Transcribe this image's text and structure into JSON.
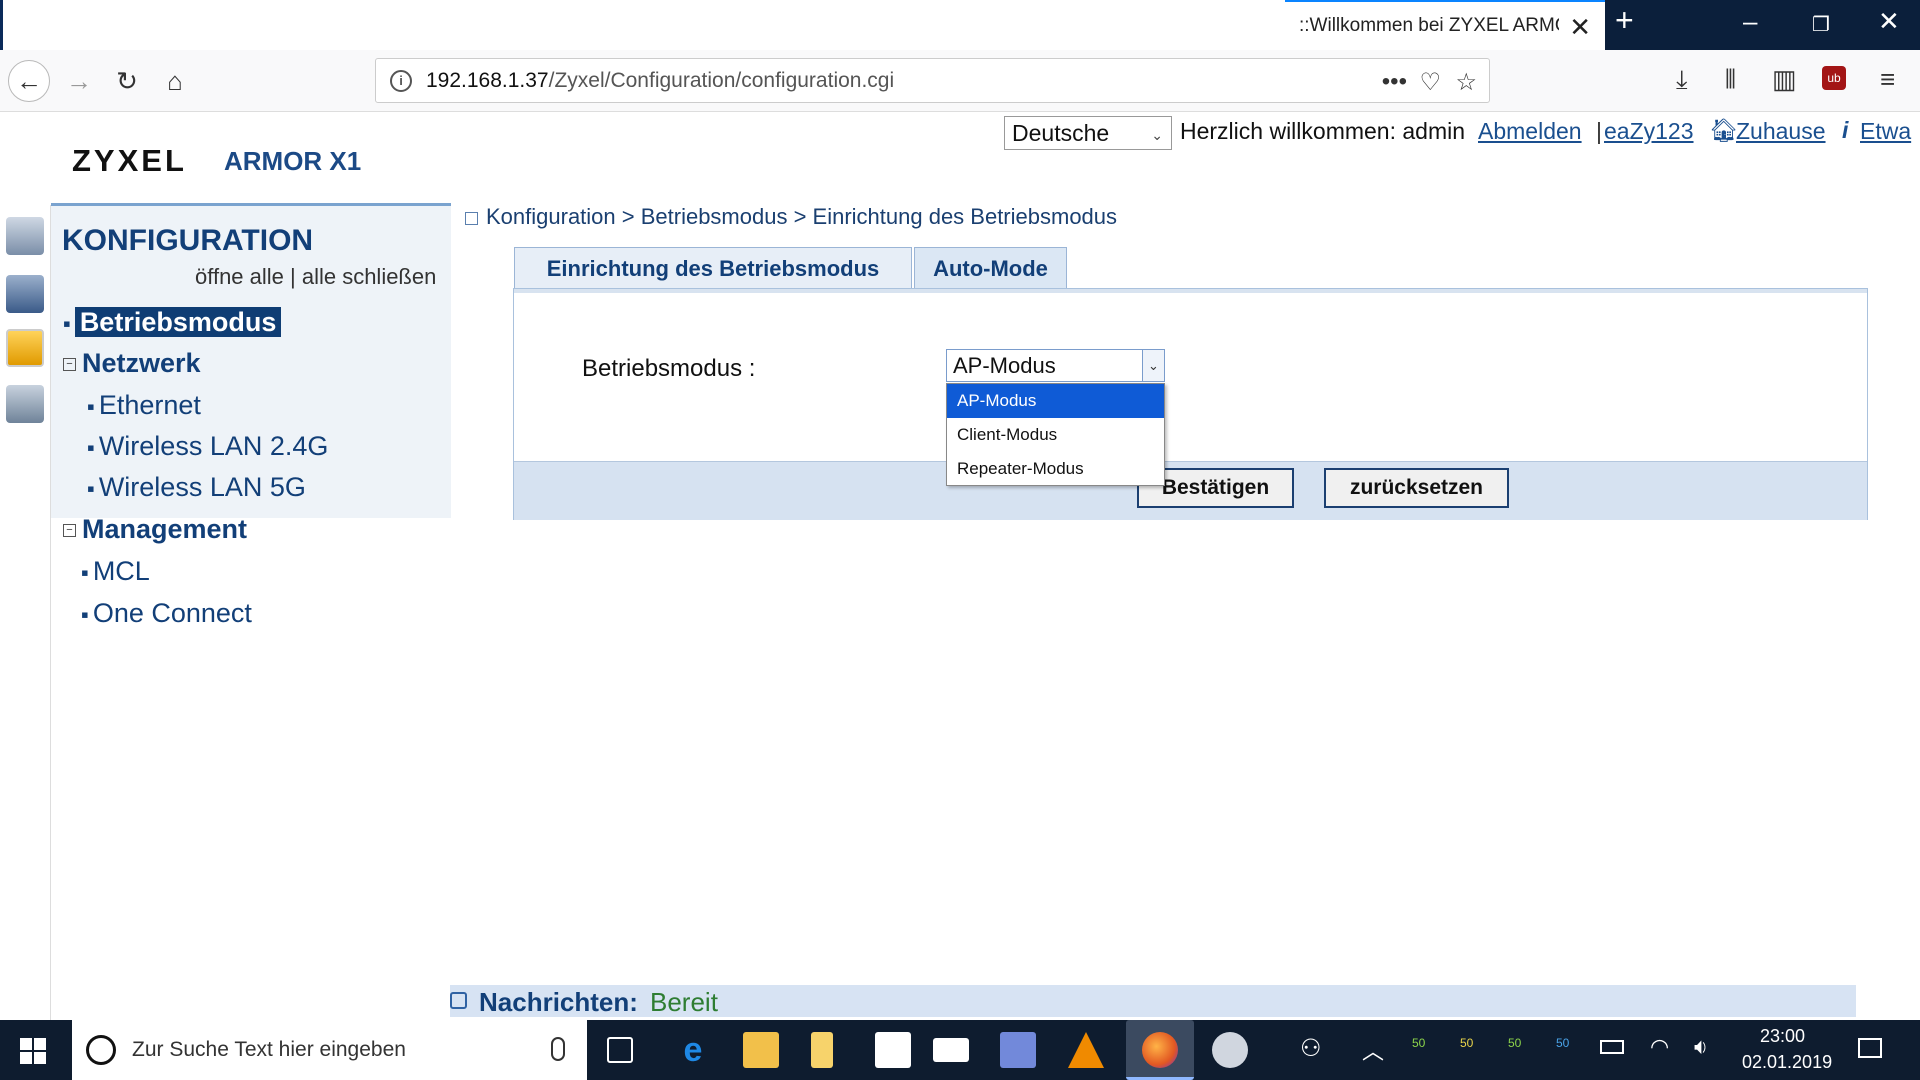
{
  "browser": {
    "tab_title": "::Willkommen bei ZYXEL ARMOR",
    "url_host": "192.168.1.37",
    "url_path": "/Zyxel/Configuration/configuration.cgi"
  },
  "header": {
    "language": "Deutsche",
    "welcome": "Herzlich willkommen: admin",
    "logout": "Abmelden",
    "user_link": "eaZy123",
    "home": "Zuhause",
    "about": "Etwa",
    "logo": "ZYXEL",
    "model": "ARMOR X1"
  },
  "sidebar": {
    "title": "KONFIGURATION",
    "open_all": "öffne alle | alle schließen",
    "items": [
      {
        "label": "Betriebsmodus"
      },
      {
        "label": "Netzwerk"
      },
      {
        "label": "Ethernet"
      },
      {
        "label": "Wireless LAN 2.4G"
      },
      {
        "label": "Wireless LAN 5G"
      },
      {
        "label": "Management"
      },
      {
        "label": "MCL"
      },
      {
        "label": "One Connect"
      }
    ]
  },
  "breadcrumb": "Konfiguration > Betriebsmodus > Einrichtung des Betriebsmodus",
  "tabs": [
    "Einrichtung des Betriebsmodus",
    "Auto-Mode"
  ],
  "form": {
    "label": "Betriebsmodus :",
    "selected": "AP-Modus",
    "options": [
      "AP-Modus",
      "Client-Modus",
      "Repeater-Modus"
    ],
    "confirm": "Bestätigen",
    "reset": "zurücksetzen"
  },
  "messages": {
    "label": "Nachrichten:",
    "value": "Bereit"
  },
  "taskbar": {
    "search_placeholder": "Zur Suche Text hier eingeben",
    "tray_values": [
      "50",
      "50",
      "50",
      "50"
    ],
    "time": "23:00",
    "date": "02.01.2019"
  }
}
